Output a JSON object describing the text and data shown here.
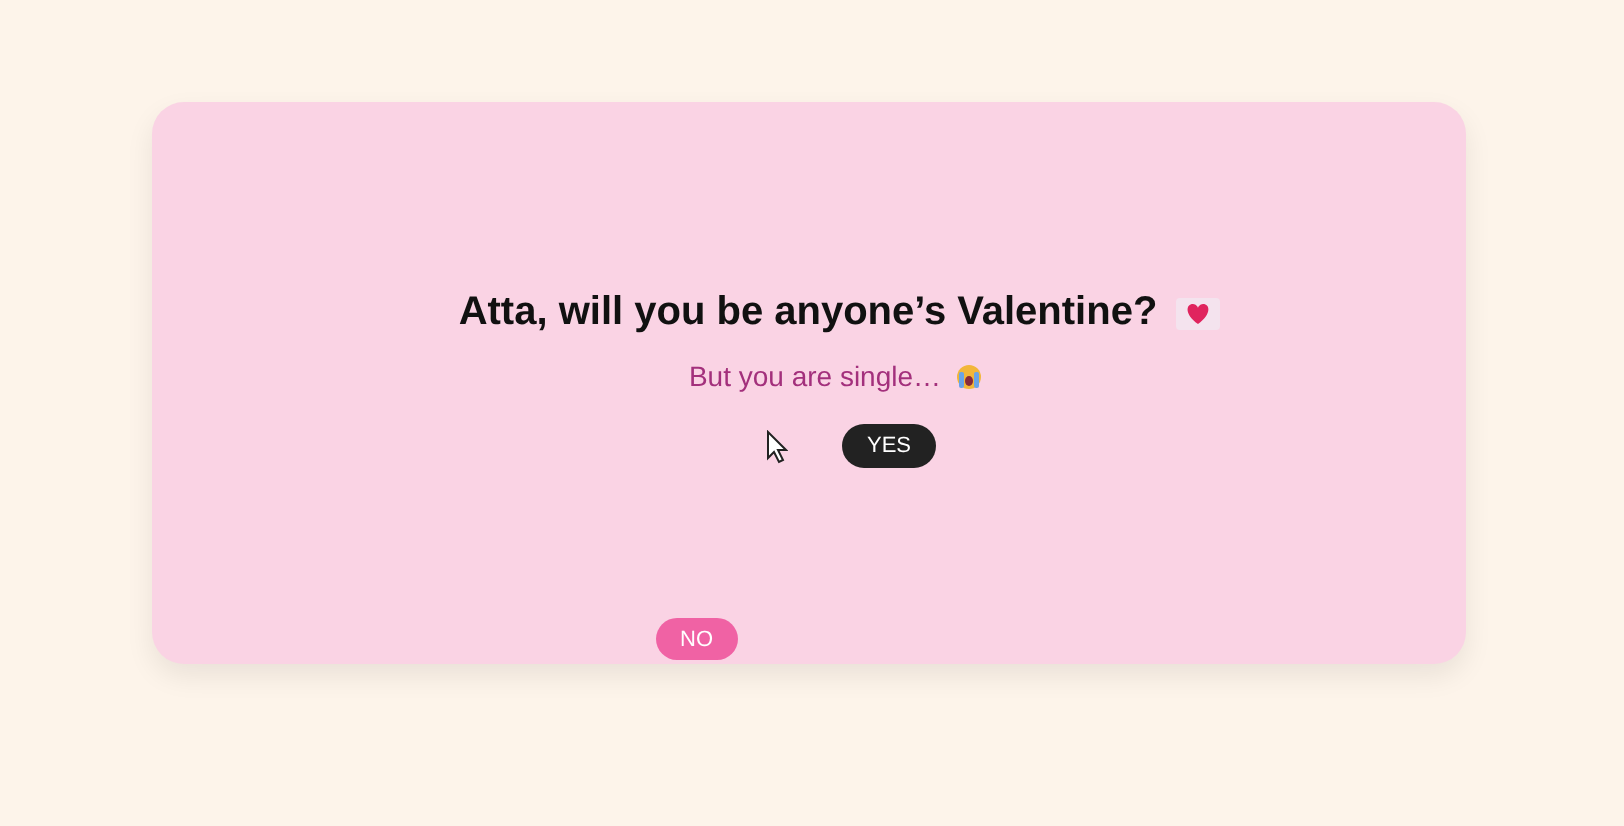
{
  "card": {
    "title": "Atta, will you be anyone’s Valentine?",
    "subtitle": "But you are single…",
    "buttons": [
      {
        "label": "YES",
        "kind": "primary"
      },
      {
        "label": "NO",
        "kind": "runaway"
      }
    ]
  }
}
